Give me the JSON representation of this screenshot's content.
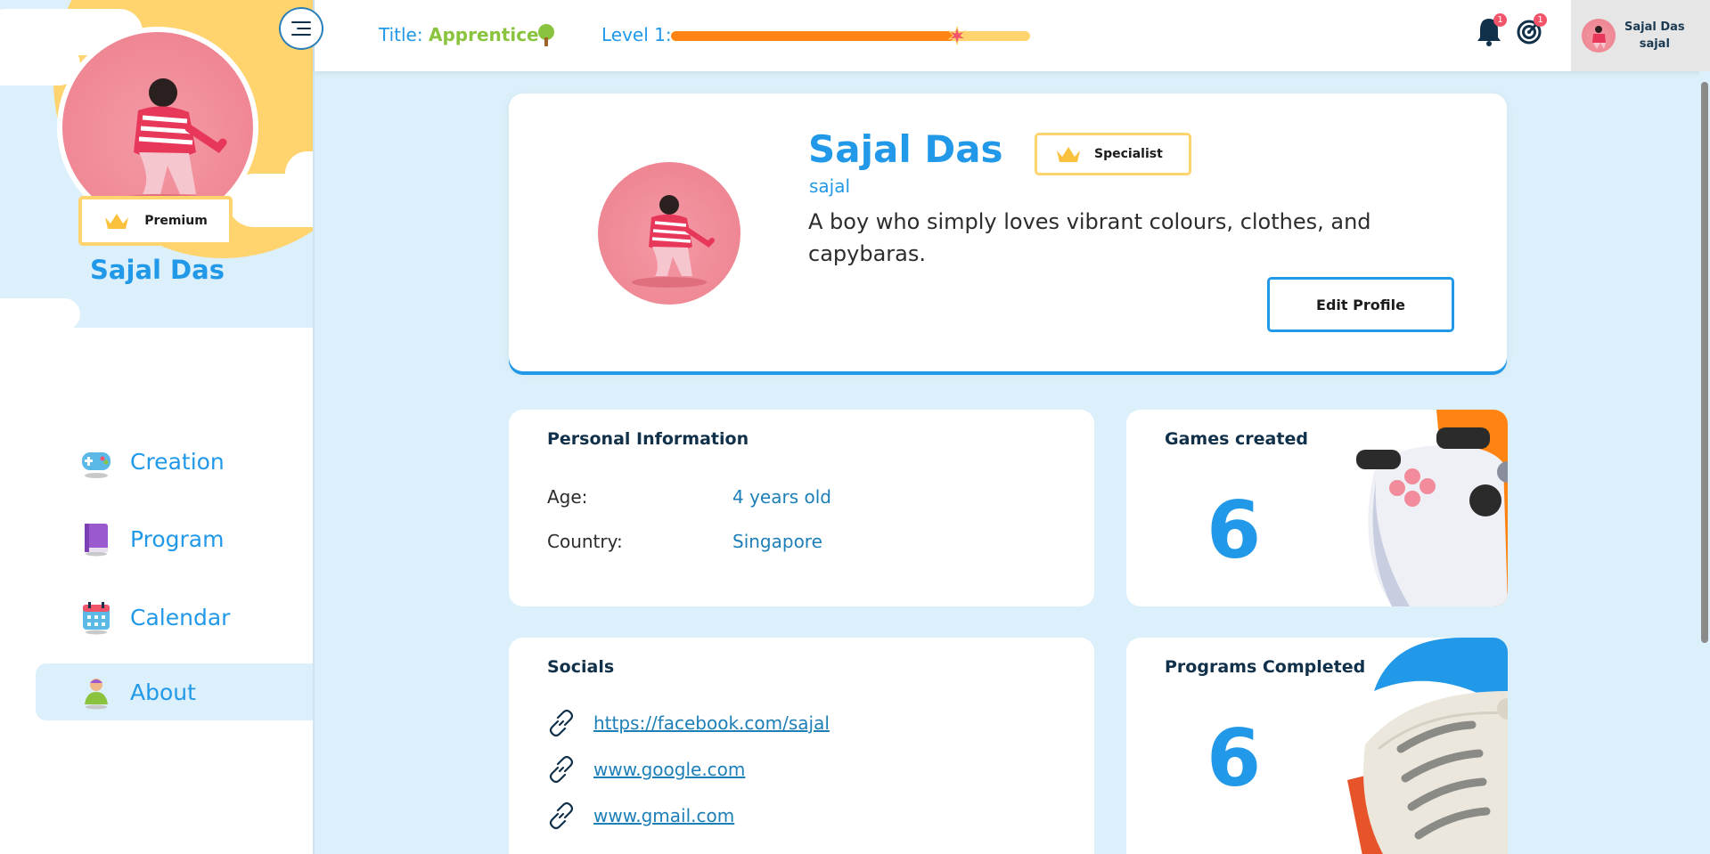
{
  "sidebar": {
    "user_name": "Sajal Das",
    "badge_label": "Premium",
    "menu_icon": "hamburger-icon",
    "nav": [
      {
        "label": "Creation",
        "icon": "gamepad-icon",
        "active": false
      },
      {
        "label": "Program",
        "icon": "book-icon",
        "active": false
      },
      {
        "label": "Calendar",
        "icon": "calendar-icon",
        "active": false
      },
      {
        "label": "About",
        "icon": "person-icon",
        "active": true
      }
    ]
  },
  "topbar": {
    "title_label": "Title:",
    "title_value": "Apprentice",
    "level_label": "Level 1:",
    "level_progress": 0.79,
    "notifications_count": "1",
    "goals_count": "1",
    "user_name": "Sajal Das",
    "user_handle": "sajal"
  },
  "profile": {
    "name": "Sajal Das",
    "username": "sajal",
    "badge_label": "Specialist",
    "bio": "A boy who simply loves vibrant colours, clothes, and capybaras.",
    "edit_label": "Edit Profile"
  },
  "personal_info": {
    "title": "Personal Information",
    "rows": [
      {
        "key": "Age:",
        "value": "4 years old"
      },
      {
        "key": "Country:",
        "value": "Singapore"
      }
    ]
  },
  "games": {
    "title": "Games created",
    "count": "6"
  },
  "programs": {
    "title": "Programs Completed",
    "count": "6"
  },
  "socials": {
    "title": "Socials",
    "links": [
      "https://facebook.com/sajal",
      "www.google.com",
      "www.gmail.com"
    ]
  },
  "colors": {
    "accent": "#2199e8",
    "gold": "#ffd36e",
    "green": "#8ac43f",
    "orange": "#ff8414",
    "bg": "#dcf0fb"
  }
}
